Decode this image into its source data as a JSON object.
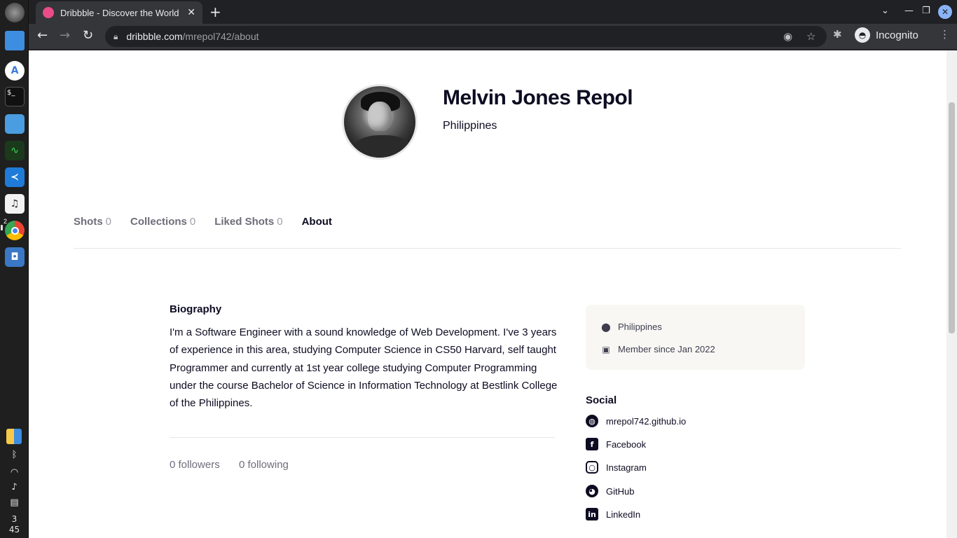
{
  "browser": {
    "tab_title": "Dribbble - Discover the World",
    "tab_close": "✕",
    "new_tab": "+",
    "url_host": "dribbble.com",
    "url_path": "/mrepol742/about",
    "incognito_label": "Incognito"
  },
  "dock": {
    "badge": "2",
    "clock_hour": "3",
    "clock_minute": "45"
  },
  "profile": {
    "name": "Melvin Jones Repol",
    "location": "Philippines"
  },
  "tabs": [
    {
      "label": "Shots",
      "count": "0"
    },
    {
      "label": "Collections",
      "count": "0"
    },
    {
      "label": "Liked Shots",
      "count": "0"
    },
    {
      "label": "About",
      "count": ""
    }
  ],
  "about": {
    "bio_title": "Biography",
    "bio_text": "I'm a Software Engineer with a sound knowledge of Web Development. I've 3 years of experience in this area, studying Computer Science in CS50 Harvard, self taught Programmer and currently at 1st year college studying Computer Programming under the course Bachelor of Science in Information Technology at Bestlink College of the Philippines.",
    "followers": "0 followers",
    "following": "0 following"
  },
  "info": {
    "location": "Philippines",
    "member_since": "Member since Jan 2022"
  },
  "social": {
    "title": "Social",
    "links": [
      {
        "label": "mrepol742.github.io",
        "icon": "globe-icon"
      },
      {
        "label": "Facebook",
        "icon": "facebook-icon"
      },
      {
        "label": "Instagram",
        "icon": "instagram-icon"
      },
      {
        "label": "GitHub",
        "icon": "github-icon"
      },
      {
        "label": "LinkedIn",
        "icon": "linkedin-icon"
      }
    ]
  }
}
